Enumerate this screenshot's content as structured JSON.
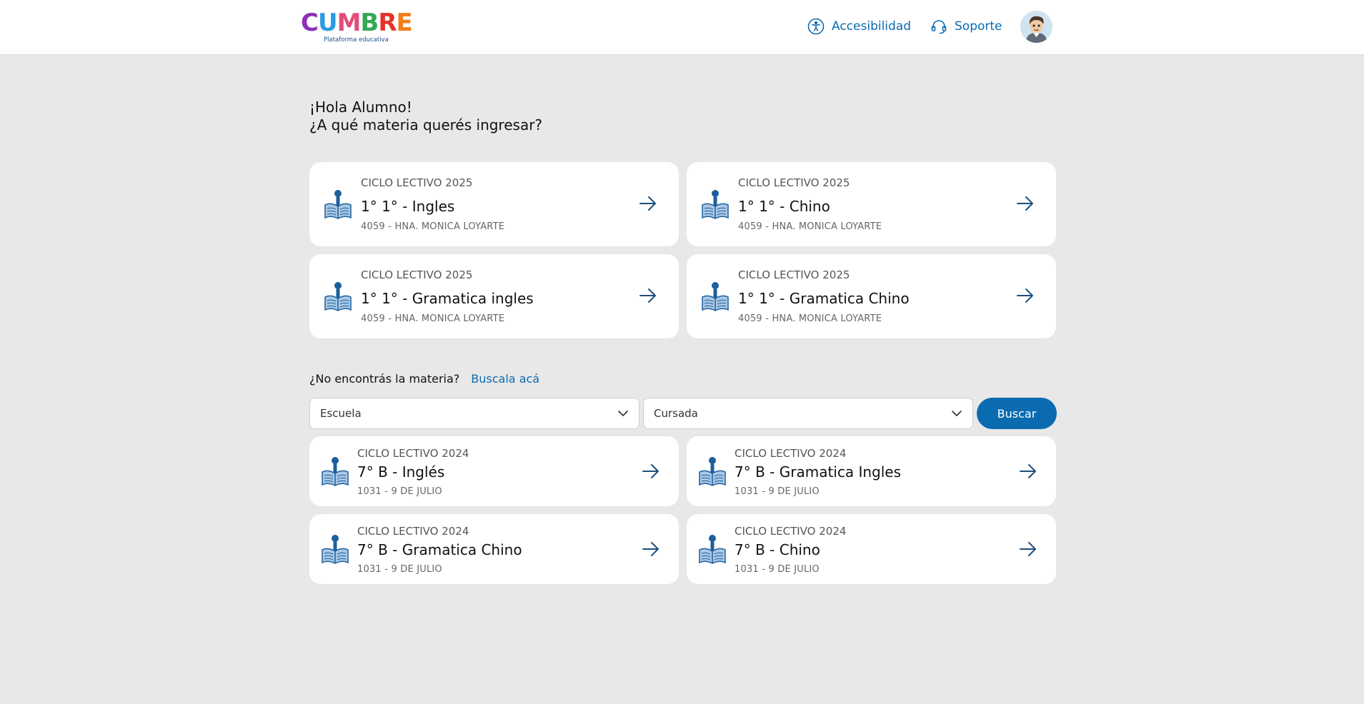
{
  "header": {
    "logo": {
      "letters": [
        "C",
        "U",
        "M",
        "B",
        "R",
        "E"
      ],
      "colors": [
        "#8e2fb8",
        "#2a9be0",
        "#e34b7a",
        "#34a853",
        "#e5332a",
        "#ef7d1a"
      ],
      "tagline": "Plataforma educativa"
    },
    "accessibility_label": "Accesibilidad",
    "support_label": "Soporte",
    "avatar_icon": "student-avatar-icon"
  },
  "greeting": {
    "line1": "¡Hola Alumno!",
    "line2": "¿A qué materia querés ingresar?"
  },
  "current_subjects": [
    {
      "cycle": "CICLO LECTIVO 2025",
      "subject": "1° 1° - Ingles",
      "school": "4059 - HNA. MONICA LOYARTE"
    },
    {
      "cycle": "CICLO LECTIVO 2025",
      "subject": "1° 1° - Chino",
      "school": "4059 - HNA. MONICA LOYARTE"
    },
    {
      "cycle": "CICLO LECTIVO 2025",
      "subject": "1° 1° - Gramatica ingles",
      "school": "4059 - HNA. MONICA LOYARTE"
    },
    {
      "cycle": "CICLO LECTIVO 2025",
      "subject": "1° 1° - Gramatica Chino",
      "school": "4059 - HNA. MONICA LOYARTE"
    }
  ],
  "search": {
    "question": "¿No encontrás la materia?",
    "link": "Buscala acá",
    "school_select": "Escuela",
    "course_select": "Cursada",
    "button": "Buscar"
  },
  "past_subjects": [
    {
      "cycle": "CICLO LECTIVO 2024",
      "subject": "7° B - Inglés",
      "school": "1031 - 9 DE JULIO"
    },
    {
      "cycle": "CICLO LECTIVO 2024",
      "subject": "7° B - Gramatica Ingles",
      "school": "1031 - 9 DE JULIO"
    },
    {
      "cycle": "CICLO LECTIVO 2024",
      "subject": "7° B - Gramatica Chino",
      "school": "1031 - 9 DE JULIO"
    },
    {
      "cycle": "CICLO LECTIVO 2024",
      "subject": "7° B - Chino",
      "school": "1031 - 9 DE JULIO"
    }
  ],
  "colors": {
    "accent": "#0a6bb0",
    "background": "#e8e8e8",
    "card": "#ffffff",
    "book": "#1d5f9c"
  }
}
